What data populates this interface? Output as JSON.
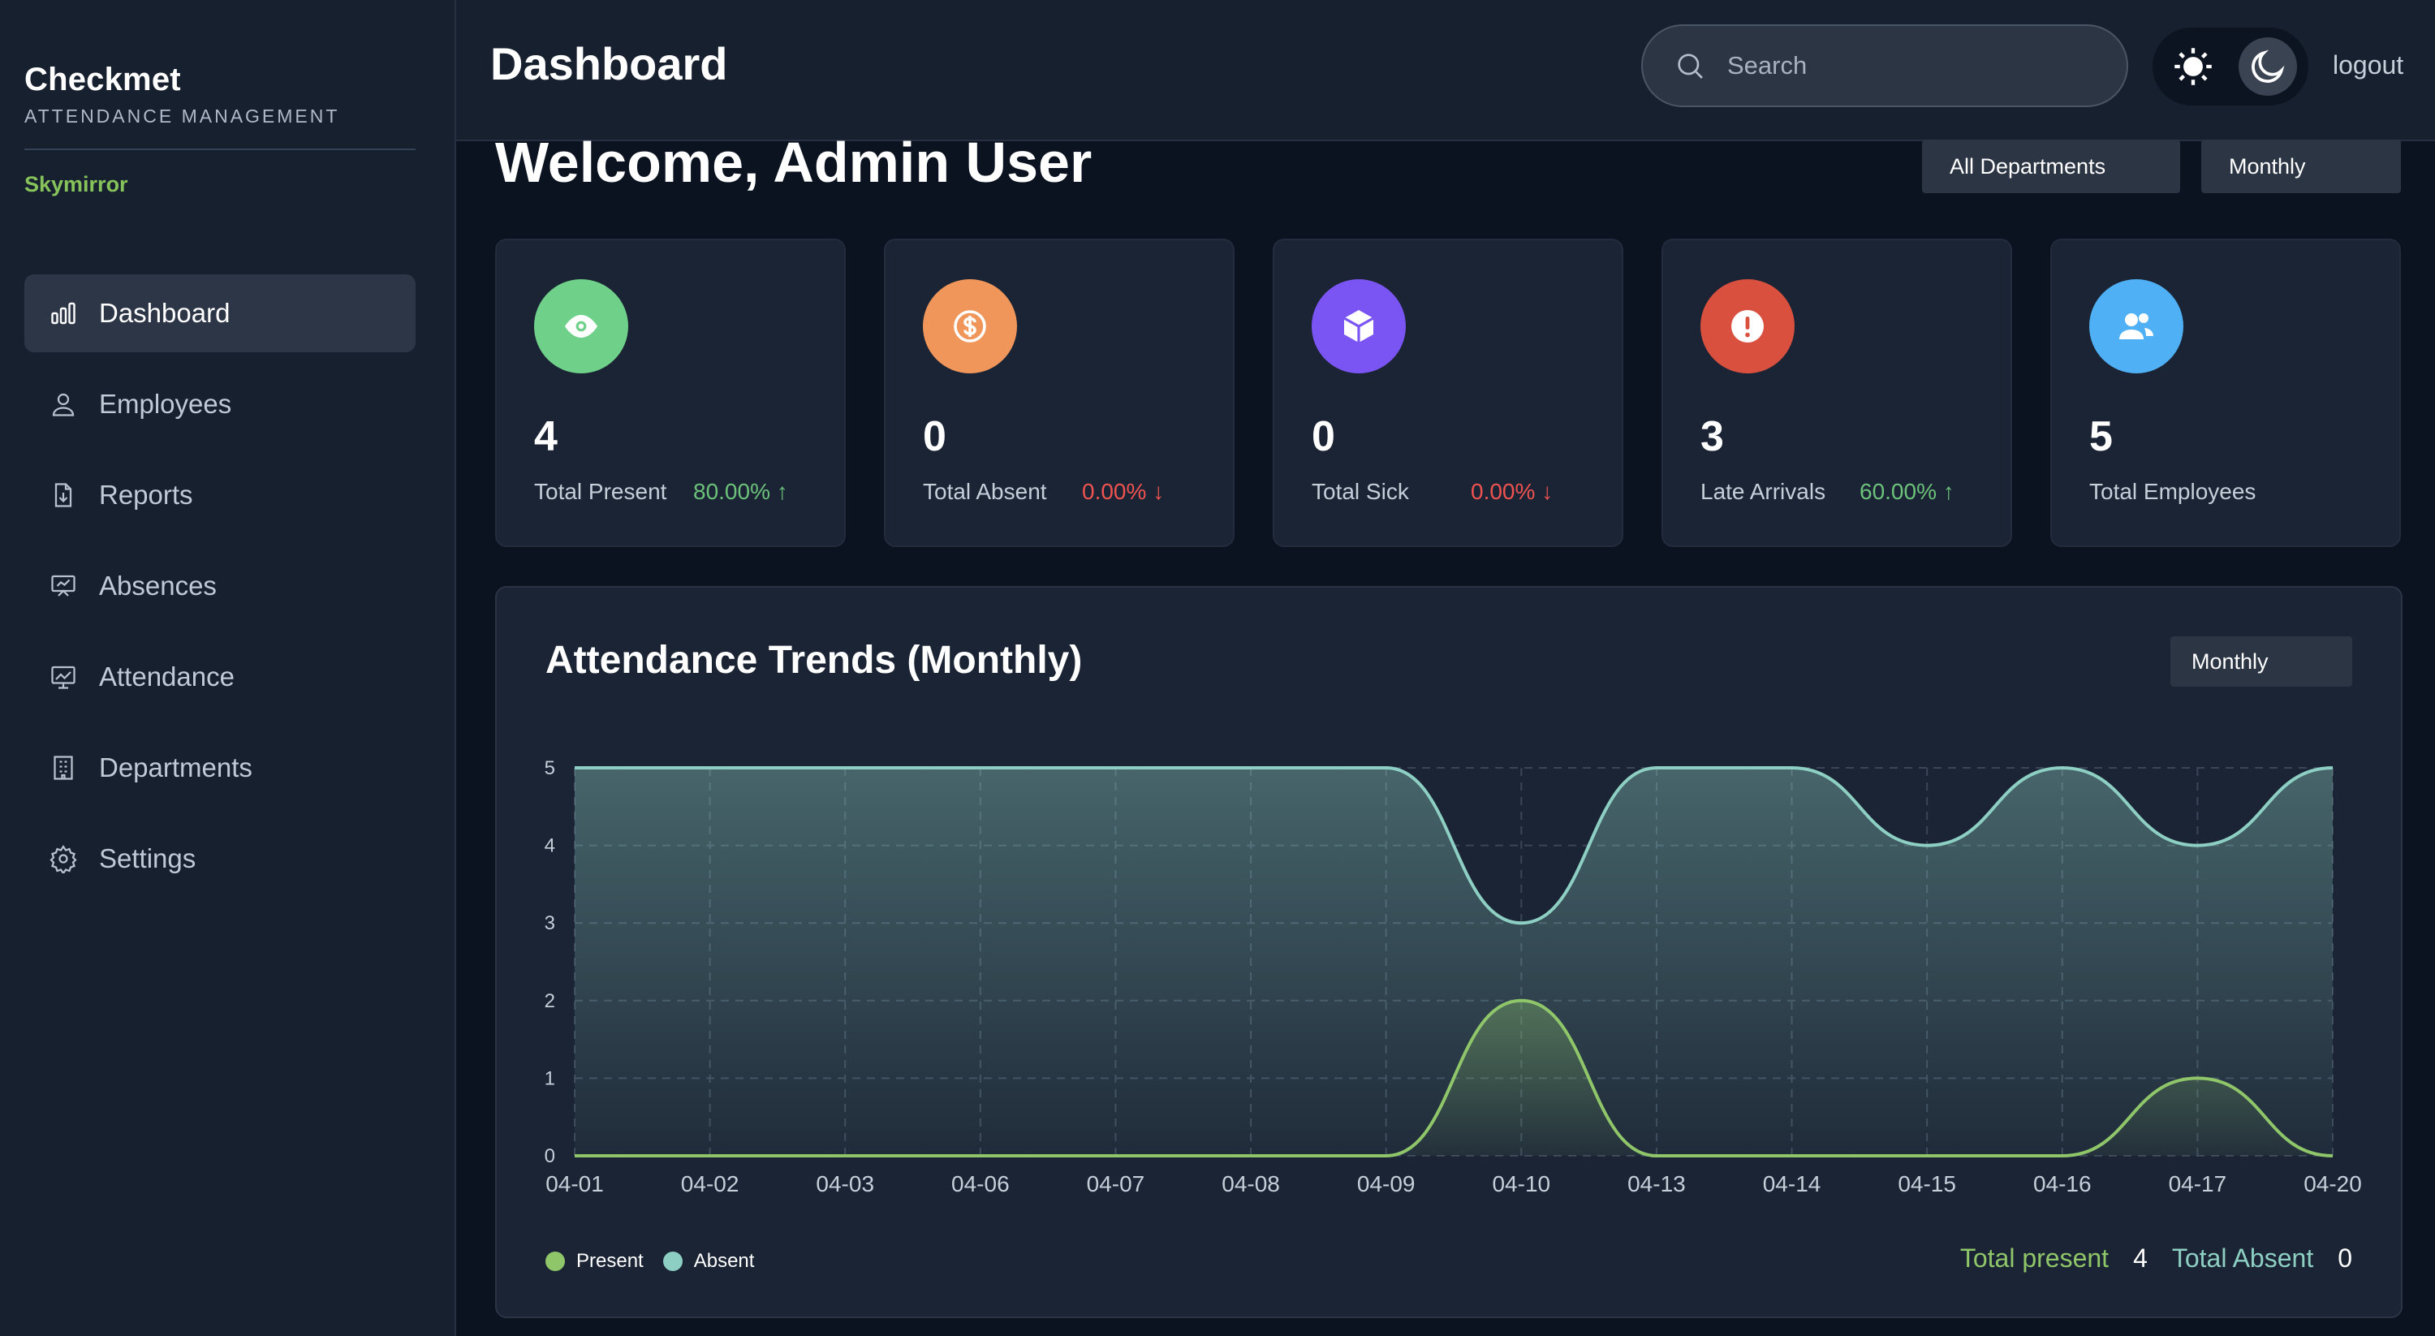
{
  "sidebar": {
    "brand": "Checkmet",
    "subtitle": "ATTENDANCE MANAGEMENT",
    "org": "Skymirror",
    "items": [
      {
        "label": "Dashboard",
        "icon": "bar-chart-icon",
        "active": true
      },
      {
        "label": "Employees",
        "icon": "user-icon"
      },
      {
        "label": "Reports",
        "icon": "file-download-icon"
      },
      {
        "label": "Absences",
        "icon": "presentation-icon"
      },
      {
        "label": "Attendance",
        "icon": "trend-chart-icon"
      },
      {
        "label": "Departments",
        "icon": "building-icon"
      },
      {
        "label": "Settings",
        "icon": "gear-icon"
      }
    ]
  },
  "header": {
    "title": "Dashboard",
    "search_placeholder": "Search",
    "logout": "logout"
  },
  "main": {
    "welcome": "Welcome, Admin User",
    "filters": {
      "department": "All Departments",
      "period": "Monthly"
    }
  },
  "cards": [
    {
      "value": "4",
      "label": "Total Present",
      "pct": "80.00%",
      "trend": "up",
      "icon": "eye-icon",
      "color": "#6fd089"
    },
    {
      "value": "0",
      "label": "Total Absent",
      "pct": "0.00%",
      "trend": "down",
      "icon": "dollar-icon",
      "color": "#f0965a"
    },
    {
      "value": "0",
      "label": "Total Sick",
      "pct": "0.00%",
      "trend": "down",
      "icon": "cube-icon",
      "color": "#7b55f3"
    },
    {
      "value": "3",
      "label": "Late Arrivals",
      "pct": "60.00%",
      "trend": "up",
      "icon": "alert-icon",
      "color": "#d9503f"
    },
    {
      "value": "5",
      "label": "Total Employees",
      "pct": "",
      "trend": "",
      "icon": "users-icon",
      "color": "#4fb0f5"
    }
  ],
  "chart_section": {
    "title": "Attendance Trends (Monthly)",
    "period": "Monthly",
    "totals": {
      "present_label": "Total present",
      "present": "4",
      "absent_label": "Total Absent",
      "absent": "0"
    }
  },
  "chart_data": {
    "type": "area",
    "categories": [
      "04-01",
      "04-02",
      "04-03",
      "04-06",
      "04-07",
      "04-08",
      "04-09",
      "04-10",
      "04-13",
      "04-14",
      "04-15",
      "04-16",
      "04-17",
      "04-20"
    ],
    "series": [
      {
        "name": "Present",
        "color": "#8fc66a",
        "values": [
          0,
          0,
          0,
          0,
          0,
          0,
          0,
          2,
          0,
          0,
          0,
          0,
          1,
          0
        ]
      },
      {
        "name": "Absent",
        "color": "#8ecfc4",
        "values": [
          5,
          5,
          5,
          5,
          5,
          5,
          5,
          3,
          5,
          5,
          4,
          5,
          4,
          5
        ]
      }
    ],
    "ylim": [
      0,
      5
    ],
    "yticks": [
      0,
      1,
      2,
      3,
      4,
      5
    ],
    "grid": true,
    "legend": "bottom-left"
  }
}
